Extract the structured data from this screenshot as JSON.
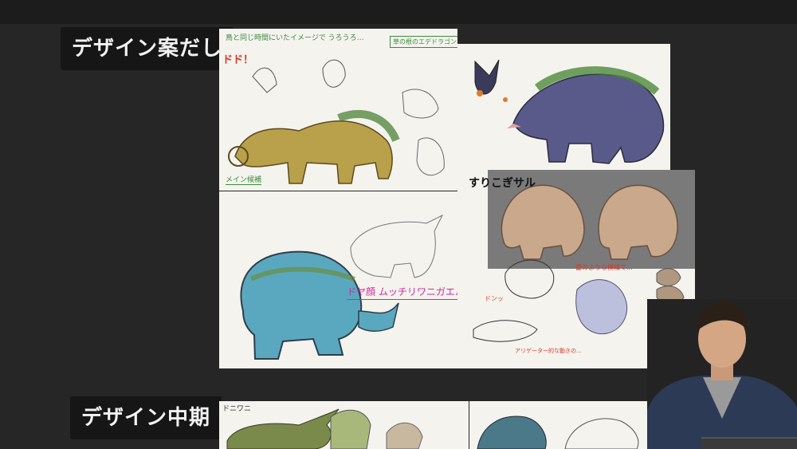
{
  "sections": {
    "early": {
      "label": "デザイン案だし"
    },
    "mid": {
      "label": "デザイン中期"
    }
  },
  "panels": {
    "dino": {
      "side_text": "ドド！",
      "top_note": "鳥と同じ時間にいたイメージで うろうろ…",
      "box_note": "草の根のエデドラゴン",
      "caption": "メイン候補"
    },
    "frog": {
      "caption": "ドヤ顔 ムッチリワニガエル"
    },
    "monkey": {
      "title": "すりこぎサル",
      "note_1": "雷のような模様で...",
      "note_2": "ドンッ",
      "note_3": "アリゲーター的な動きの..."
    },
    "mid": {
      "title": "ドニワニ"
    }
  },
  "colors": {
    "background": "#262626",
    "label_bg": "#161616",
    "label_text": "#f2f2f2",
    "paper": "#f4f3ee",
    "note_green": "#3c8a3c",
    "note_pink": "#d02aa0",
    "note_red": "#d43a2a"
  }
}
